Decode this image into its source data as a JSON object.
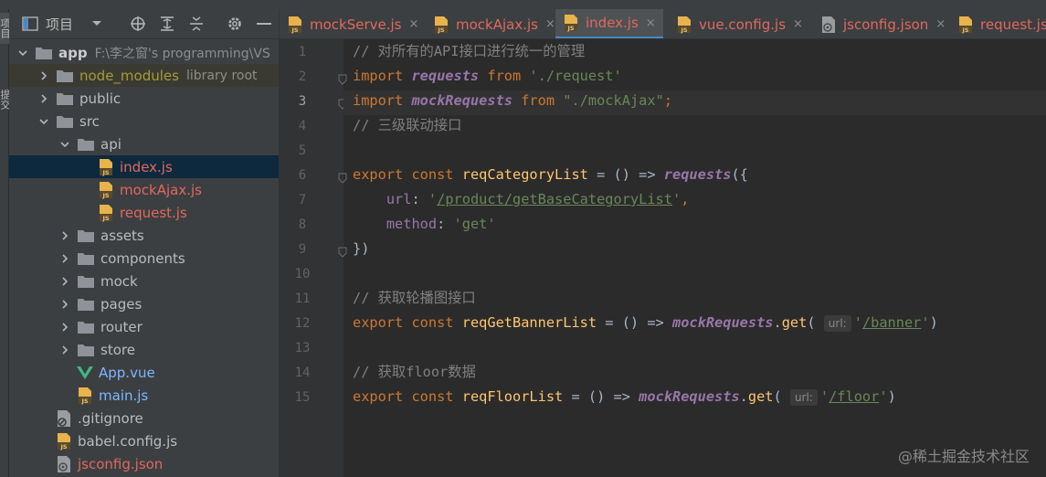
{
  "side_tabs": [
    "项目",
    "提交"
  ],
  "project_panel": {
    "title": "项目",
    "tree": [
      {
        "label": "app",
        "sub": "F:\\李之窗's programming\\VS",
        "depth": 0,
        "expanded": true,
        "kind": "folder",
        "style": "bold"
      },
      {
        "label": "node_modules",
        "sub": "library root",
        "depth": 1,
        "expanded": false,
        "kind": "folder",
        "style": "olive"
      },
      {
        "label": "public",
        "sub": "",
        "depth": 1,
        "expanded": false,
        "kind": "folder",
        "style": ""
      },
      {
        "label": "src",
        "sub": "",
        "depth": 1,
        "expanded": true,
        "kind": "folder",
        "style": ""
      },
      {
        "label": "api",
        "sub": "",
        "depth": 2,
        "expanded": true,
        "kind": "folder",
        "style": ""
      },
      {
        "label": "index.js",
        "sub": "",
        "depth": 3,
        "kind": "js",
        "style": "red",
        "selected": true
      },
      {
        "label": "mockAjax.js",
        "sub": "",
        "depth": 3,
        "kind": "js",
        "style": "red"
      },
      {
        "label": "request.js",
        "sub": "",
        "depth": 3,
        "kind": "js",
        "style": "red"
      },
      {
        "label": "assets",
        "sub": "",
        "depth": 2,
        "expanded": false,
        "kind": "folder",
        "style": ""
      },
      {
        "label": "components",
        "sub": "",
        "depth": 2,
        "expanded": false,
        "kind": "folder",
        "style": ""
      },
      {
        "label": "mock",
        "sub": "",
        "depth": 2,
        "expanded": false,
        "kind": "folder",
        "style": ""
      },
      {
        "label": "pages",
        "sub": "",
        "depth": 2,
        "expanded": false,
        "kind": "folder",
        "style": ""
      },
      {
        "label": "router",
        "sub": "",
        "depth": 2,
        "expanded": false,
        "kind": "folder",
        "style": ""
      },
      {
        "label": "store",
        "sub": "",
        "depth": 2,
        "expanded": false,
        "kind": "folder",
        "style": ""
      },
      {
        "label": "App.vue",
        "sub": "",
        "depth": 2,
        "kind": "vue",
        "style": "blue"
      },
      {
        "label": "main.js",
        "sub": "",
        "depth": 2,
        "kind": "js",
        "style": "blue"
      },
      {
        "label": ".gitignore",
        "sub": "",
        "depth": 1,
        "kind": "gitignore",
        "style": ""
      },
      {
        "label": "babel.config.js",
        "sub": "",
        "depth": 1,
        "kind": "js",
        "style": ""
      },
      {
        "label": "jsconfig.json",
        "sub": "",
        "depth": 1,
        "kind": "json",
        "style": "red"
      }
    ]
  },
  "editor": {
    "tabs": [
      {
        "label": "mockServe.js",
        "icon": "js",
        "close": "×",
        "active": false
      },
      {
        "label": "mockAjax.js",
        "icon": "js",
        "close": "×",
        "active": false
      },
      {
        "label": "index.js",
        "icon": "js",
        "close": "×",
        "active": true
      },
      {
        "label": "vue.config.js",
        "icon": "js",
        "close": "×",
        "active": false
      },
      {
        "label": "jsconfig.json",
        "icon": "json",
        "close": "×",
        "active": false
      },
      {
        "label": "request.js",
        "icon": "js",
        "close": "",
        "active": false
      }
    ],
    "current_line": 3,
    "lines": [
      [
        {
          "t": "// 对所有的API接口进行统一的管理",
          "c": "com"
        }
      ],
      [
        {
          "t": "import ",
          "c": "kw"
        },
        {
          "t": "requests",
          "c": "it"
        },
        {
          "t": " from ",
          "c": "kw"
        },
        {
          "t": "'./request'",
          "c": "str"
        }
      ],
      [
        {
          "t": "import ",
          "c": "kw"
        },
        {
          "t": "mockRequests",
          "c": "it"
        },
        {
          "t": " from ",
          "c": "kw"
        },
        {
          "t": "\"./mockAjax\"",
          "c": "str"
        },
        {
          "t": ";",
          "c": "kw"
        }
      ],
      [
        {
          "t": "// 三级联动接口",
          "c": "com"
        }
      ],
      [],
      [
        {
          "t": "export const ",
          "c": "kw"
        },
        {
          "t": "reqCategoryList",
          "c": "fn"
        },
        {
          "t": " = () => ",
          "c": ""
        },
        {
          "t": "requests",
          "c": "it"
        },
        {
          "t": "({",
          "c": ""
        }
      ],
      [
        {
          "t": "    url",
          "c": "prop"
        },
        {
          "t": ": ",
          "c": ""
        },
        {
          "t": "'",
          "c": "str"
        },
        {
          "t": "/product/getBaseCategoryList",
          "c": "strl"
        },
        {
          "t": "'",
          "c": "str"
        },
        {
          "t": ",",
          "c": "kw"
        }
      ],
      [
        {
          "t": "    method",
          "c": "prop"
        },
        {
          "t": ": ",
          "c": ""
        },
        {
          "t": "'get'",
          "c": "str"
        }
      ],
      [
        {
          "t": "})",
          "c": ""
        }
      ],
      [],
      [
        {
          "t": "// 获取轮播图接口",
          "c": "com"
        }
      ],
      [
        {
          "t": "export const ",
          "c": "kw"
        },
        {
          "t": "reqGetBannerList",
          "c": "fn"
        },
        {
          "t": " = () => ",
          "c": ""
        },
        {
          "t": "mockRequests",
          "c": "it"
        },
        {
          "t": ".",
          "c": ""
        },
        {
          "t": "get",
          "c": "fn"
        },
        {
          "t": "( ",
          "c": ""
        },
        {
          "t": "url:",
          "c": "hint"
        },
        {
          "t": "'",
          "c": "str"
        },
        {
          "t": "/banner",
          "c": "strl"
        },
        {
          "t": "'",
          "c": "str"
        },
        {
          "t": ")",
          "c": ""
        }
      ],
      [],
      [
        {
          "t": "// 获取floor数据",
          "c": "com"
        }
      ],
      [
        {
          "t": "export const ",
          "c": "kw"
        },
        {
          "t": "reqFloorList",
          "c": "fn"
        },
        {
          "t": " = () => ",
          "c": ""
        },
        {
          "t": "mockRequests",
          "c": "it"
        },
        {
          "t": ".",
          "c": ""
        },
        {
          "t": "get",
          "c": "fn"
        },
        {
          "t": "( ",
          "c": ""
        },
        {
          "t": "url:",
          "c": "hint"
        },
        {
          "t": "'",
          "c": "str"
        },
        {
          "t": "/floor",
          "c": "strl"
        },
        {
          "t": "'",
          "c": "str"
        },
        {
          "t": ")",
          "c": ""
        }
      ]
    ]
  },
  "watermark": "@稀土掘金技术社区",
  "colors": {
    "keyword": "#cc7832",
    "function": "#ffc66d",
    "string": "#6a8759",
    "comment": "#808080",
    "property": "#9876aa",
    "error_file": "#e0685e",
    "modified_file": "#7eb6ff"
  }
}
